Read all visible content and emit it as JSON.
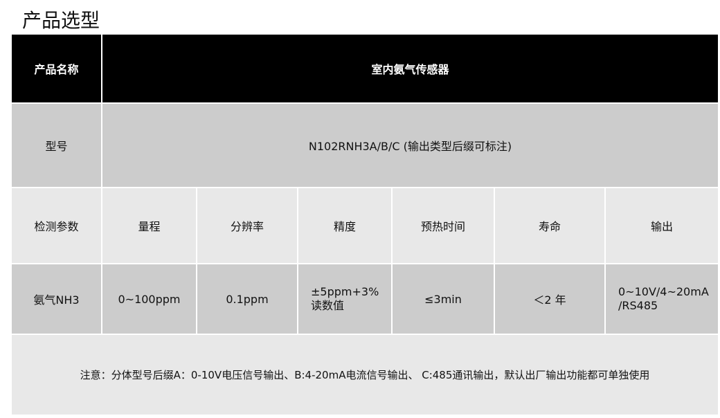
{
  "title": "产品选型",
  "table": {
    "header": {
      "label": "产品名称",
      "value": "室内氨气传感器"
    },
    "model": {
      "label": "型号",
      "value": "N102RNH3A/B/C (输出类型后缀可标注)"
    },
    "params": {
      "label": "检测参数",
      "columns": [
        "量程",
        "分辨率",
        "精度",
        "预热时间",
        "寿命",
        "输出"
      ]
    },
    "gas": {
      "label": "氨气NH3",
      "range": "0~100ppm",
      "resolution": "0.1ppm",
      "accuracy_line1": "±5ppm+3%",
      "accuracy_line2": "读数值",
      "warmup": "≤3min",
      "life": "＜2 年",
      "output_line1": "0~10V/4~20mA",
      "output_line2": "/RS485"
    },
    "note": "注意：分体型号后缀A：0-10V电压信号输出、B:4-20mA电流信号输出、 C:485通讯输出，默认出厂输出功能都可单独使用"
  }
}
